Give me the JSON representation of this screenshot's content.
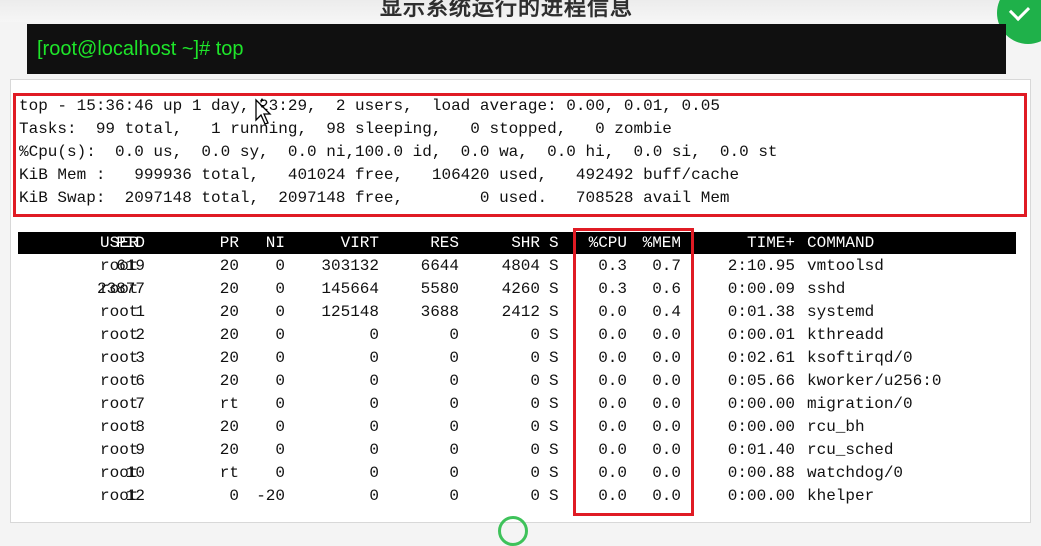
{
  "title_fragment": "显示系统运行的进程信息",
  "command": "[root@localhost ~]# top",
  "summary": [
    "top - 15:36:46 up 1 day, 23:29,  2 users,  load average: 0.00, 0.01, 0.05",
    "Tasks:  99 total,   1 running,  98 sleeping,   0 stopped,   0 zombie",
    "%Cpu(s):  0.0 us,  0.0 sy,  0.0 ni,100.0 id,  0.0 wa,  0.0 hi,  0.0 si,  0.0 st",
    "KiB Mem :   999936 total,   401024 free,   106420 used,   492492 buff/cache",
    "KiB Swap:  2097148 total,  2097148 free,        0 used.   708528 avail Mem"
  ],
  "table": {
    "headers": [
      "PID",
      "USER",
      "PR",
      "NI",
      "VIRT",
      "RES",
      "SHR",
      "S",
      "%CPU",
      "%MEM",
      "TIME+",
      "COMMAND"
    ],
    "rows": [
      [
        "619",
        "root",
        "20",
        "0",
        "303132",
        "6644",
        "4804",
        "S",
        "0.3",
        "0.7",
        "2:10.95",
        "vmtoolsd"
      ],
      [
        "23877",
        "root",
        "20",
        "0",
        "145664",
        "5580",
        "4260",
        "S",
        "0.3",
        "0.6",
        "0:00.09",
        "sshd"
      ],
      [
        "1",
        "root",
        "20",
        "0",
        "125148",
        "3688",
        "2412",
        "S",
        "0.0",
        "0.4",
        "0:01.38",
        "systemd"
      ],
      [
        "2",
        "root",
        "20",
        "0",
        "0",
        "0",
        "0",
        "S",
        "0.0",
        "0.0",
        "0:00.01",
        "kthreadd"
      ],
      [
        "3",
        "root",
        "20",
        "0",
        "0",
        "0",
        "0",
        "S",
        "0.0",
        "0.0",
        "0:02.61",
        "ksoftirqd/0"
      ],
      [
        "6",
        "root",
        "20",
        "0",
        "0",
        "0",
        "0",
        "S",
        "0.0",
        "0.0",
        "0:05.66",
        "kworker/u256:0"
      ],
      [
        "7",
        "root",
        "rt",
        "0",
        "0",
        "0",
        "0",
        "S",
        "0.0",
        "0.0",
        "0:00.00",
        "migration/0"
      ],
      [
        "8",
        "root",
        "20",
        "0",
        "0",
        "0",
        "0",
        "S",
        "0.0",
        "0.0",
        "0:00.00",
        "rcu_bh"
      ],
      [
        "9",
        "root",
        "20",
        "0",
        "0",
        "0",
        "0",
        "S",
        "0.0",
        "0.0",
        "0:01.40",
        "rcu_sched"
      ],
      [
        "10",
        "root",
        "rt",
        "0",
        "0",
        "0",
        "0",
        "S",
        "0.0",
        "0.0",
        "0:00.88",
        "watchdog/0"
      ],
      [
        "12",
        "root",
        "0",
        "-20",
        "0",
        "0",
        "0",
        "S",
        "0.0",
        "0.0",
        "0:00.00",
        "khelper"
      ]
    ]
  },
  "colors": {
    "highlight": "#e01b24",
    "prompt_green": "#1ee52a",
    "terminal_bg": "#101010"
  }
}
